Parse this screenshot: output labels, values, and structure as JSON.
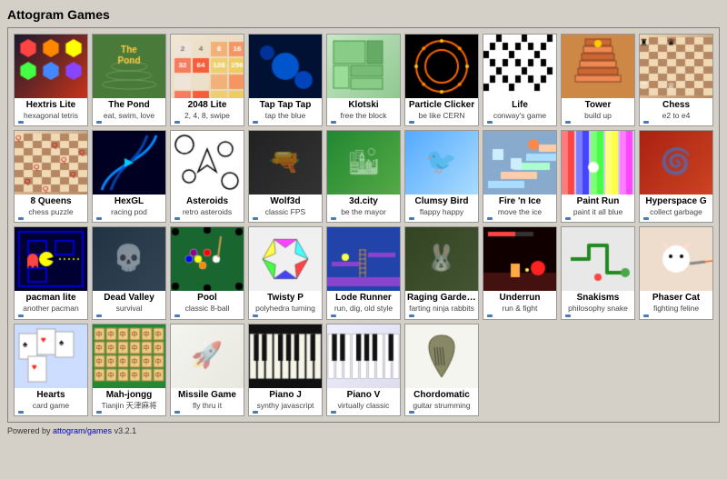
{
  "header": {
    "title": "Attogram Games"
  },
  "footer": {
    "text": "Powered by ",
    "link_text": "attogram/games",
    "version": " v3.2.1"
  },
  "games": [
    {
      "id": "hextris",
      "title": "Hextris Lite",
      "subtitle": "hexagonal tetris",
      "thumb_class": "thumb-hextris",
      "icon": "⬡"
    },
    {
      "id": "pond",
      "title": "The Pond",
      "subtitle": "eat, swim, love",
      "thumb_class": "thumb-pond",
      "icon": "🌊"
    },
    {
      "id": "2048",
      "title": "2048 Lite",
      "subtitle": "2, 4, 8, swipe",
      "thumb_class": "thumb-2048",
      "icon": "🔢"
    },
    {
      "id": "taptap",
      "title": "Tap Tap Tap",
      "subtitle": "tap the blue",
      "thumb_class": "thumb-taptap",
      "icon": "⚫"
    },
    {
      "id": "klotski",
      "title": "Klotski",
      "subtitle": "free the block",
      "thumb_class": "thumb-klotski",
      "icon": "🟩"
    },
    {
      "id": "particle",
      "title": "Particle Clicker",
      "subtitle": "be like CERN",
      "thumb_class": "thumb-particle",
      "icon": "⚛"
    },
    {
      "id": "life",
      "title": "Life",
      "subtitle": "conway's game",
      "thumb_class": "thumb-life",
      "icon": "⬛"
    },
    {
      "id": "tower",
      "title": "Tower",
      "subtitle": "build up",
      "thumb_class": "thumb-tower",
      "icon": "🏗"
    },
    {
      "id": "chess",
      "title": "Chess",
      "subtitle": "e2 to e4",
      "thumb_class": "thumb-chess",
      "icon": "♟"
    },
    {
      "id": "8queens",
      "title": "8 Queens",
      "subtitle": "chess puzzle",
      "thumb_class": "thumb-8queens",
      "icon": "♛"
    },
    {
      "id": "hexgl",
      "title": "HexGL",
      "subtitle": "racing pod",
      "thumb_class": "thumb-hexgl",
      "icon": "🚀"
    },
    {
      "id": "asteroids",
      "title": "Asteroids",
      "subtitle": "retro asteroids",
      "thumb_class": "thumb-asteroids",
      "icon": "☆"
    },
    {
      "id": "wolf3d",
      "title": "Wolf3d",
      "subtitle": "classic FPS",
      "thumb_class": "thumb-wolf3d",
      "icon": "🔫"
    },
    {
      "id": "3dcity",
      "title": "3d.city",
      "subtitle": "be the mayor",
      "thumb_class": "thumb-3dcity",
      "icon": "🏙"
    },
    {
      "id": "clumsy",
      "title": "Clumsy Bird",
      "subtitle": "flappy happy",
      "thumb_class": "thumb-clumsy",
      "icon": "🐦"
    },
    {
      "id": "fireice",
      "title": "Fire 'n Ice",
      "subtitle": "move the ice",
      "thumb_class": "thumb-fireice",
      "icon": "🧊"
    },
    {
      "id": "paintrun",
      "title": "Paint Run",
      "subtitle": "paint it all blue",
      "thumb_class": "thumb-paintrun",
      "icon": "🎨"
    },
    {
      "id": "hyperspace",
      "title": "Hyperspace G",
      "subtitle": "collect garbage",
      "thumb_class": "thumb-hyperspace",
      "icon": "🌀"
    },
    {
      "id": "pacman",
      "title": "pacman lite",
      "subtitle": "another pacman",
      "thumb_class": "thumb-pacman",
      "icon": "👾"
    },
    {
      "id": "deadvalley",
      "title": "Dead Valley",
      "subtitle": "survival",
      "thumb_class": "thumb-deadvalley",
      "icon": "💀"
    },
    {
      "id": "pool",
      "title": "Pool",
      "subtitle": "classic 8-ball",
      "thumb_class": "thumb-pool",
      "icon": "🎱"
    },
    {
      "id": "twisty",
      "title": "Twisty P",
      "subtitle": "polyhedra turning",
      "thumb_class": "thumb-twisty",
      "icon": "⬡"
    },
    {
      "id": "lode",
      "title": "Lode Runner",
      "subtitle": "run, dig, old style",
      "thumb_class": "thumb-lode",
      "icon": "🏃"
    },
    {
      "id": "raging",
      "title": "Raging Gardens",
      "subtitle": "farting ninja rabbits",
      "thumb_class": "thumb-raging",
      "icon": "🐰"
    },
    {
      "id": "underrun",
      "title": "Underrun",
      "subtitle": "run & fight",
      "thumb_class": "thumb-underrun",
      "icon": "⚔"
    },
    {
      "id": "snakisms",
      "title": "Snakisms",
      "subtitle": "philosophy snake",
      "thumb_class": "thumb-snakisms",
      "icon": "🐍"
    },
    {
      "id": "phasercat",
      "title": "Phaser Cat",
      "subtitle": "fighting feline",
      "thumb_class": "thumb-phasercat",
      "icon": "🐱"
    },
    {
      "id": "hearts",
      "title": "Hearts",
      "subtitle": "card game",
      "thumb_class": "thumb-hearts",
      "icon": "♥"
    },
    {
      "id": "mahjongg",
      "title": "Mah-jongg",
      "subtitle": "Tianjin 天津麻将",
      "thumb_class": "thumb-mahjongg",
      "icon": "🀄"
    },
    {
      "id": "missile",
      "title": "Missile Game",
      "subtitle": "fly thru it",
      "thumb_class": "thumb-missile",
      "icon": "🚀"
    },
    {
      "id": "pianoj",
      "title": "Piano J",
      "subtitle": "synthy javascript",
      "thumb_class": "thumb-pianoj",
      "icon": "🎹"
    },
    {
      "id": "pianov",
      "title": "Piano V",
      "subtitle": "virtually classic",
      "thumb_class": "thumb-pianov",
      "icon": "🎹"
    },
    {
      "id": "chordo",
      "title": "Chordomatic",
      "subtitle": "guitar strumming",
      "thumb_class": "thumb-chordo",
      "icon": "🎸"
    }
  ]
}
